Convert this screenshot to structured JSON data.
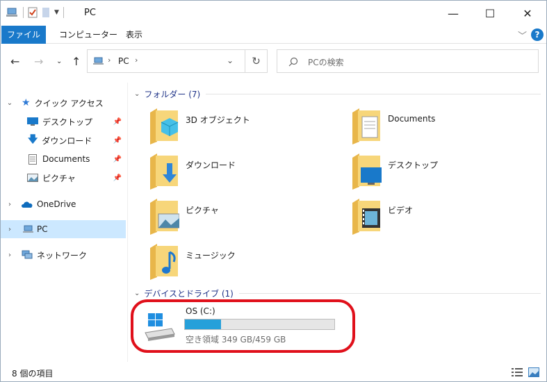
{
  "window": {
    "title": "PC",
    "buttons": {
      "minimize": "—",
      "maximize": "☐",
      "close": "✕"
    }
  },
  "ribbon": {
    "tabs": [
      {
        "label": "ファイル"
      },
      {
        "label": "コンピューター"
      },
      {
        "label": "表示"
      }
    ],
    "help": "?"
  },
  "nav": {
    "breadcrumb": [
      "PC"
    ],
    "search_placeholder": "PCの検索"
  },
  "sidebar": {
    "quick_access": "クイック アクセス",
    "pinned": [
      {
        "label": "デスクトップ",
        "icon": "desktop-icon"
      },
      {
        "label": "ダウンロード",
        "icon": "download-icon"
      },
      {
        "label": "Documents",
        "icon": "documents-icon"
      },
      {
        "label": "ピクチャ",
        "icon": "pictures-icon"
      }
    ],
    "onedrive": "OneDrive",
    "pc": "PC",
    "network": "ネットワーク"
  },
  "content": {
    "folders_header": "フォルダー (7)",
    "folders": [
      {
        "label": "3D オブジェクト",
        "icon": "3d-objects-folder-icon"
      },
      {
        "label": "Documents",
        "icon": "documents-folder-icon"
      },
      {
        "label": "ダウンロード",
        "icon": "downloads-folder-icon"
      },
      {
        "label": "デスクトップ",
        "icon": "desktop-folder-icon"
      },
      {
        "label": "ピクチャ",
        "icon": "pictures-folder-icon"
      },
      {
        "label": "ビデオ",
        "icon": "videos-folder-icon"
      },
      {
        "label": "ミュージック",
        "icon": "music-folder-icon"
      }
    ],
    "drives_header": "デバイスとドライブ (1)",
    "drive": {
      "label": "OS (C:)",
      "free_text": "空き領域 349 GB/459 GB",
      "used_fraction": 0.24
    }
  },
  "status": {
    "items": "8 個の項目"
  },
  "colors": {
    "accent": "#1979ca",
    "selected": "#cce8ff",
    "drive_fill": "#26a0da",
    "highlight": "#e0101b"
  }
}
